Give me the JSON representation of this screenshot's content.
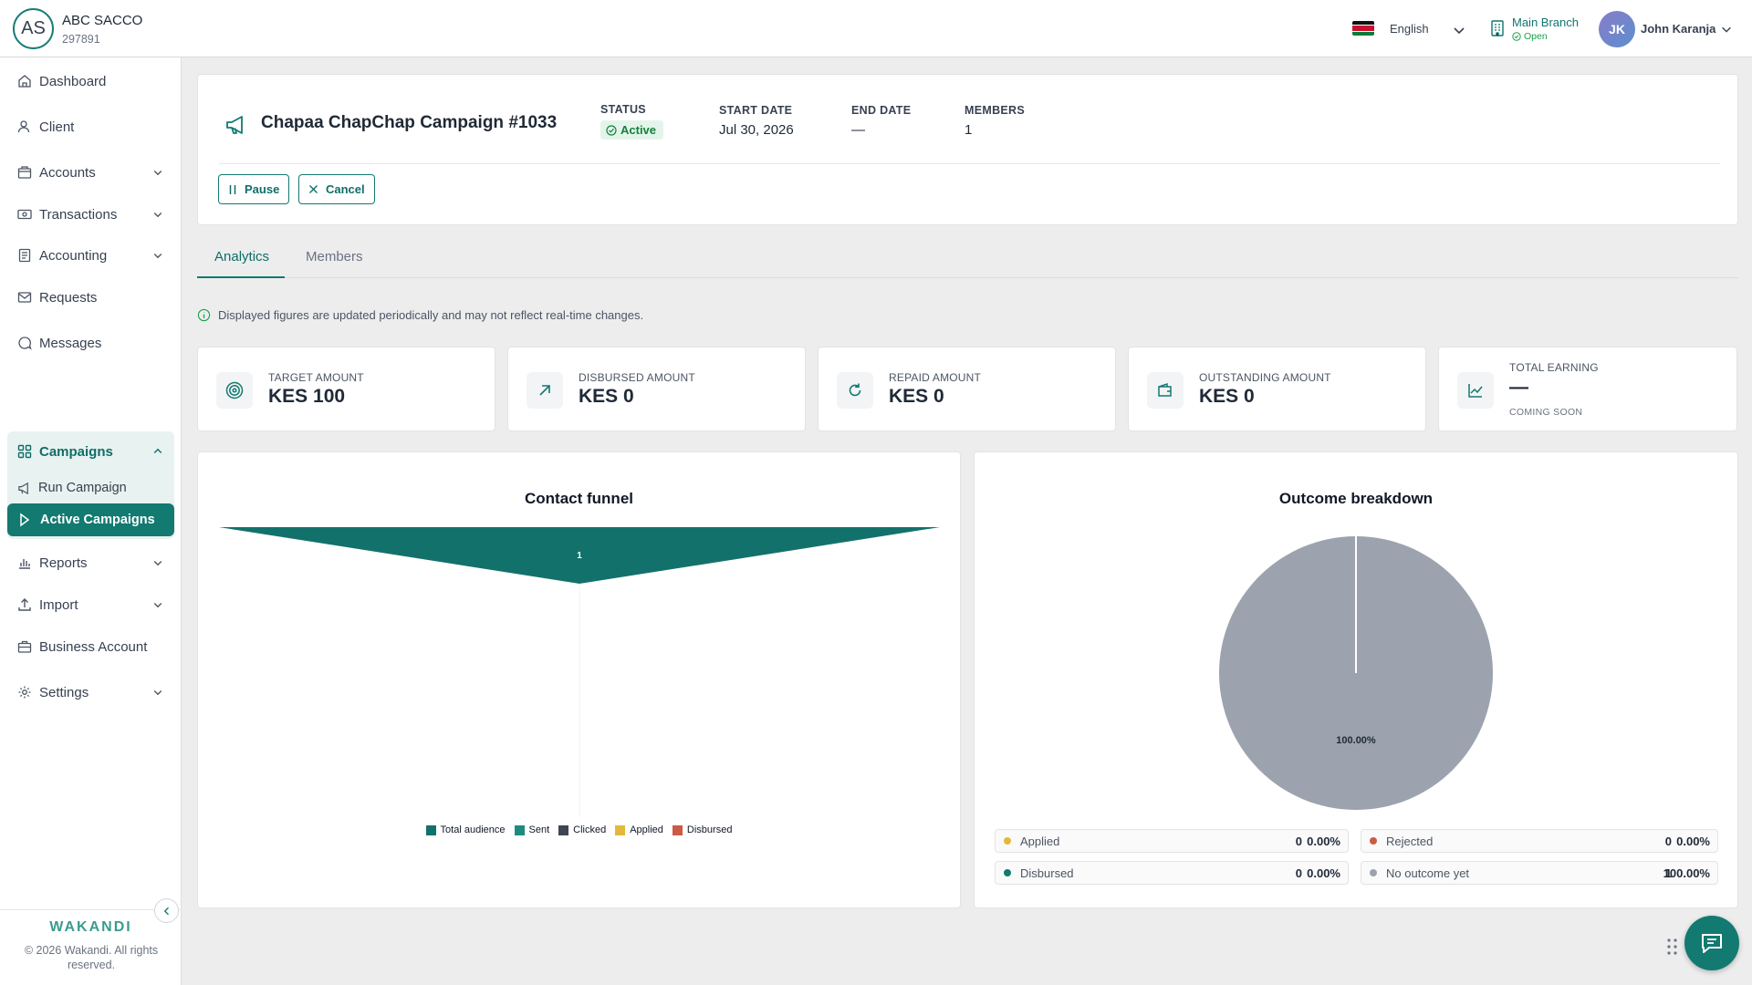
{
  "org": {
    "initials": "AS",
    "name": "ABC SACCO",
    "code": "297891"
  },
  "header": {
    "language": "English",
    "branch_name": "Main Branch",
    "branch_status": "Open",
    "user_initials": "JK",
    "user_name": "John Karanja"
  },
  "sidebar": {
    "items": [
      {
        "label": "Dashboard"
      },
      {
        "label": "Client"
      },
      {
        "label": "Accounts"
      },
      {
        "label": "Transactions"
      },
      {
        "label": "Accounting"
      },
      {
        "label": "Requests"
      },
      {
        "label": "Messages"
      },
      {
        "label": "Campaigns"
      },
      {
        "label": "Reports"
      },
      {
        "label": "Import"
      },
      {
        "label": "Business Account"
      },
      {
        "label": "Settings"
      }
    ],
    "campaign_sub": [
      {
        "label": "Run Campaign"
      },
      {
        "label": "Active Campaigns"
      }
    ],
    "brand": "WAKANDI",
    "copyright": "© 2026 Wakandi. All rights reserved."
  },
  "campaign": {
    "title": "Chapaa ChapChap Campaign #1033",
    "status_label": "STATUS",
    "status": "Active",
    "start_label": "START DATE",
    "start": "Jul 30, 2026",
    "end_label": "END DATE",
    "end": "—",
    "members_label": "MEMBERS",
    "members": "1",
    "pause_label": "Pause",
    "cancel_label": "Cancel"
  },
  "tabs": [
    {
      "label": "Analytics"
    },
    {
      "label": "Members"
    }
  ],
  "notice": "Displayed figures are updated periodically and may not reflect real-time changes.",
  "stats": [
    {
      "label": "TARGET AMOUNT",
      "value": "KES 100"
    },
    {
      "label": "DISBURSED AMOUNT",
      "value": "KES 0"
    },
    {
      "label": "REPAID AMOUNT",
      "value": "KES 0"
    },
    {
      "label": "OUTSTANDING AMOUNT",
      "value": "KES 0"
    },
    {
      "label": "TOTAL EARNING",
      "value": "—",
      "sub": "COMING SOON"
    }
  ],
  "colors": {
    "primary": "#127a70",
    "total_audience": "#12726b",
    "sent": "#1f8a80",
    "clicked": "#3d4650",
    "applied": "#e2b93b",
    "disbursed": "#cc5a45",
    "no_outcome": "#9ca3af",
    "rejected": "#cc5a45"
  },
  "chart_data": [
    {
      "type": "funnel",
      "title": "Contact funnel",
      "categories": [
        "Total audience",
        "Sent",
        "Clicked",
        "Applied",
        "Disbursed"
      ],
      "values": [
        1,
        0,
        0,
        0,
        0
      ],
      "data_labels": [
        "1"
      ],
      "legend": [
        "Total audience",
        "Sent",
        "Clicked",
        "Applied",
        "Disbursed"
      ],
      "legend_position": "bottom"
    },
    {
      "type": "pie",
      "title": "Outcome breakdown",
      "categories": [
        "Applied",
        "Rejected",
        "Disbursed",
        "No outcome yet"
      ],
      "values": [
        0,
        0,
        0,
        1
      ],
      "percentages": [
        "0.00%",
        "0.00%",
        "0.00%",
        "100.00%"
      ],
      "data_label": "100.00%"
    }
  ],
  "outcomes": [
    {
      "label": "Applied",
      "count": "0",
      "pct": "0.00%"
    },
    {
      "label": "Rejected",
      "count": "0",
      "pct": "0.00%"
    },
    {
      "label": "Disbursed",
      "count": "0",
      "pct": "0.00%"
    },
    {
      "label": "No outcome yet",
      "count": "1",
      "pct": "100.00%"
    }
  ]
}
